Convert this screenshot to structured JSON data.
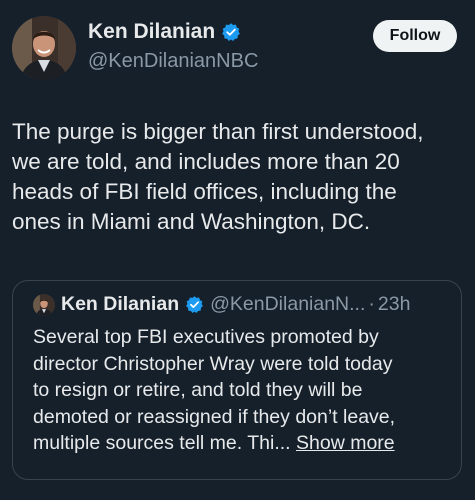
{
  "author": {
    "name": "Ken Dilanian",
    "handle": "@KenDilanianNBC",
    "verified_color": "#1d9bf0"
  },
  "follow_button": {
    "label": "Follow"
  },
  "tweet": {
    "lines": [
      "The purge is bigger than first understood,",
      "we are told, and includes more than 20",
      "heads of FBI field offices, including the",
      "ones in Miami and Washington, DC."
    ]
  },
  "quoted_tweet": {
    "author_name": "Ken Dilanian",
    "handle": "@KenDilanianN...",
    "separator": "·",
    "time": "23h",
    "lines": [
      "Several top FBI executives promoted by",
      "director Christopher Wray were told today",
      "to resign or retire, and told they will be",
      "demoted or reassigned if they don’t leave,"
    ],
    "last_line": "multiple sources tell me. Thi...",
    "show_more_label": "Show more"
  },
  "colors": {
    "background": "#15202b",
    "text_primary": "#e7e9ea",
    "text_secondary": "#8b98a5",
    "border": "#38444d",
    "follow_bg": "#eff3f4"
  },
  "icons": {
    "verified": "verified-badge-icon",
    "avatar": "profile-photo"
  }
}
